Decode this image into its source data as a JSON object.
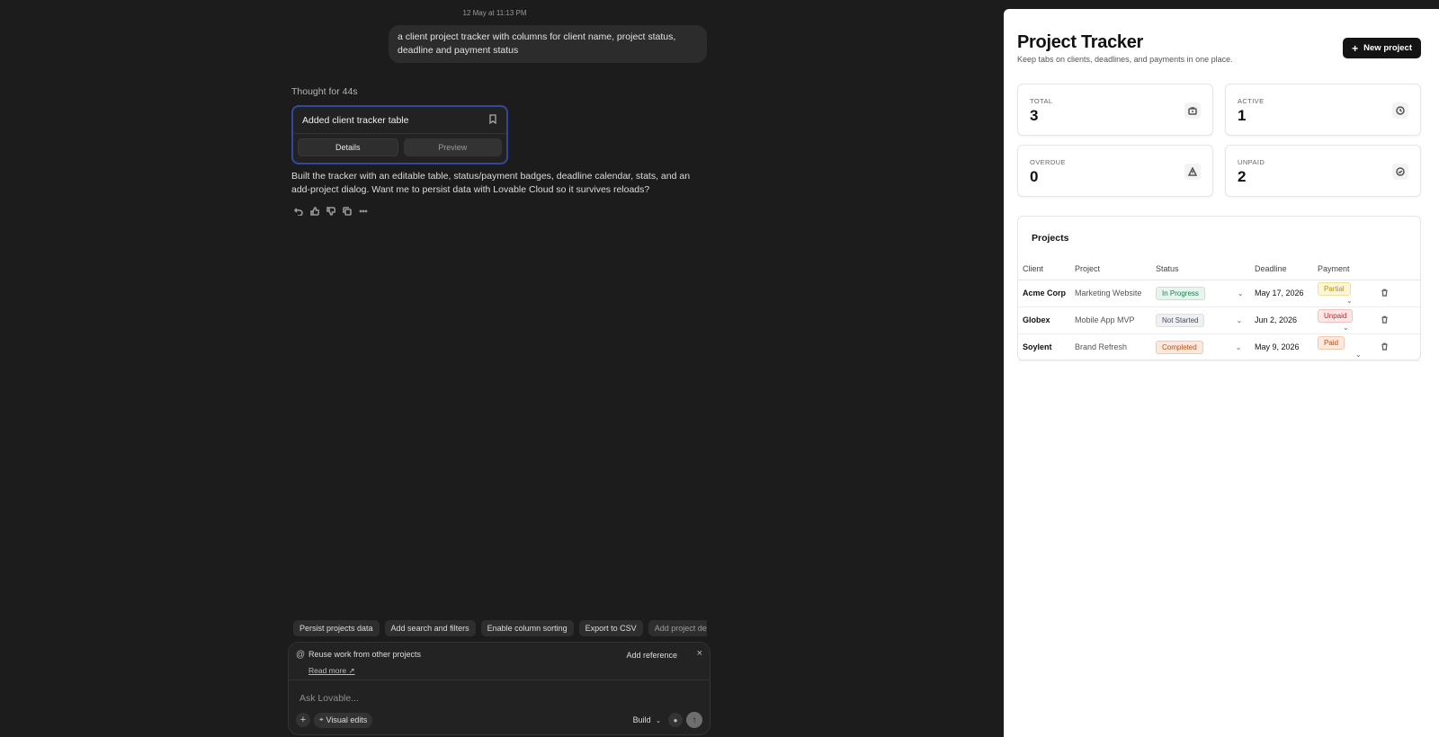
{
  "chat": {
    "timestamp": "12 May at 11:13 PM",
    "user_message": "a client project tracker with columns for client name, project status, deadline and payment status",
    "thought": "Thought for 44s",
    "edit_card": {
      "title": "Added client tracker table",
      "tab_details": "Details",
      "tab_preview": "Preview"
    },
    "assistant_message": "Built the tracker with an editable table, status/payment badges, deadline calendar, stats, and an add-project dialog. Want me to persist data with Lovable Cloud so it survives reloads?",
    "action_icons": [
      "undo-icon",
      "thumbs-up-icon",
      "thumbs-down-icon",
      "copy-icon",
      "more-icon"
    ]
  },
  "suggestions": [
    "Persist projects data",
    "Add search and filters",
    "Enable column sorting",
    "Export to CSV",
    "Add project details"
  ],
  "composer": {
    "reuse_text": "Reuse work from other projects",
    "read_more": "Read more",
    "add_reference": "Add reference",
    "placeholder": "Ask Lovable...",
    "visual_edits": "Visual edits",
    "mode": "Build"
  },
  "preview": {
    "title": "Project Tracker",
    "subtitle": "Keep tabs on clients, deadlines, and payments in one place.",
    "new_button": "New project",
    "stats": {
      "total_label": "TOTAL",
      "total_value": "3",
      "active_label": "ACTIVE",
      "active_value": "1",
      "overdue_label": "OVERDUE",
      "overdue_value": "0",
      "unpaid_label": "UNPAID",
      "unpaid_value": "2"
    },
    "projects_title": "Projects",
    "columns": [
      "Client",
      "Project",
      "Status",
      "Deadline",
      "Payment"
    ],
    "rows": [
      {
        "client": "Acme Corp",
        "project": "Marketing Website",
        "status": "In Progress",
        "deadline": "May 17, 2026",
        "payment": "Partial"
      },
      {
        "client": "Globex",
        "project": "Mobile App MVP",
        "status": "Not Started",
        "deadline": "Jun 2, 2026",
        "payment": "Unpaid"
      },
      {
        "client": "Soylent",
        "project": "Brand Refresh",
        "status": "Completed",
        "deadline": "May 9, 2026",
        "payment": "Paid"
      }
    ]
  }
}
